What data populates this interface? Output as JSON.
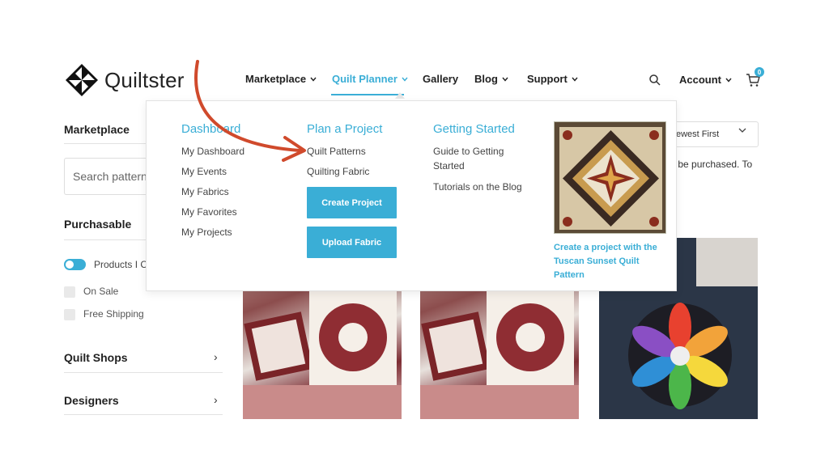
{
  "brand": {
    "name": "Quiltster",
    "accent": "#3aaed6",
    "arrow_color": "#d04a2c"
  },
  "nav": {
    "items": [
      "Marketplace",
      "Quilt Planner",
      "Gallery",
      "Blog",
      "Support"
    ],
    "active": "Quilt Planner",
    "account": "Account",
    "cart_count": "0"
  },
  "sidebar": {
    "marketplace_title": "Marketplace",
    "search_placeholder": "Search patterns",
    "purchasable_title": "Purchasable",
    "toggle_label": "Products I Ca",
    "on_sale": "On Sale",
    "free_shipping": "Free Shipping",
    "quilt_shops": "Quilt Shops",
    "designers": "Designers"
  },
  "sort": {
    "selected": "ewest First"
  },
  "partial_text": "y be purchased. To",
  "mega_menu": {
    "dashboard": {
      "title": "Dashboard",
      "links": [
        "My Dashboard",
        "My Events",
        "My Fabrics",
        "My Favorites",
        "My Projects"
      ]
    },
    "plan": {
      "title": "Plan a Project",
      "links": [
        "Quilt Patterns",
        "Quilting Fabric"
      ],
      "create_button": "Create Project",
      "upload_button": "Upload Fabric"
    },
    "getting_started": {
      "title": "Getting Started",
      "links": [
        "Guide to Getting Started",
        "Tutorials on the Blog"
      ]
    },
    "feature": {
      "caption": "Create a project with the Tuscan Sunset Quilt Pattern"
    }
  }
}
